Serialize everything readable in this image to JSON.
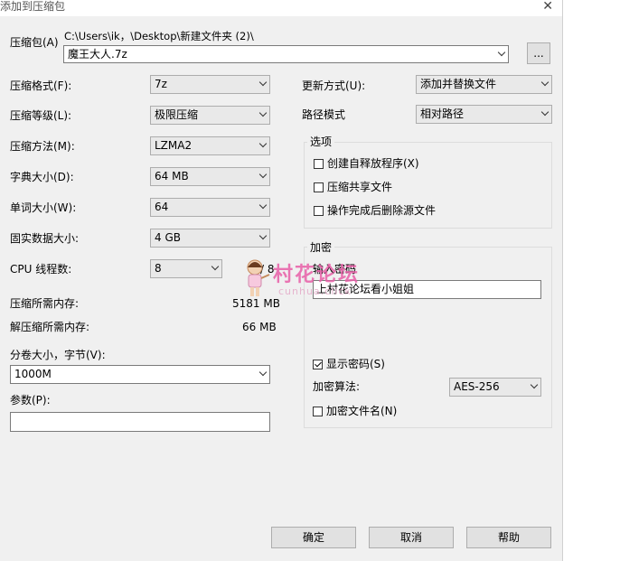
{
  "window": {
    "title": "添加到压缩包",
    "close_glyph": "✕"
  },
  "archive": {
    "label": "压缩包(A)",
    "path": "C:\\Users\\ik，\\Desktop\\新建文件夹 (2)\\",
    "filename": "魔王大人.7z",
    "browse_label": "..."
  },
  "left_fields": {
    "format": {
      "label": "压缩格式(F):",
      "value": "7z"
    },
    "level": {
      "label": "压缩等级(L):",
      "value": "极限压缩"
    },
    "method": {
      "label": "压缩方法(M):",
      "value": "LZMA2"
    },
    "dict": {
      "label": "字典大小(D):",
      "value": "64 MB"
    },
    "word": {
      "label": "单词大小(W):",
      "value": "64"
    },
    "solid": {
      "label": "固实数据大小:",
      "value": "4 GB"
    },
    "cpu": {
      "label": "CPU 线程数:",
      "value": "8",
      "max": "/ 8"
    }
  },
  "memory": {
    "compress_label": "压缩所需内存:",
    "compress_value": "5181 MB",
    "decompress_label": "解压缩所需内存:",
    "decompress_value": "66 MB"
  },
  "volume": {
    "label": "分卷大小，字节(V):",
    "value": "1000M"
  },
  "params": {
    "label": "参数(P):",
    "value": ""
  },
  "right_fields": {
    "update": {
      "label": "更新方式(U):",
      "value": "添加并替换文件"
    },
    "pathmode": {
      "label": "路径模式",
      "value": "相对路径"
    }
  },
  "options": {
    "title": "选项",
    "items": [
      {
        "label": "创建自释放程序(X)",
        "checked": false
      },
      {
        "label": "压缩共享文件",
        "checked": false
      },
      {
        "label": "操作完成后删除源文件",
        "checked": false
      }
    ]
  },
  "encryption": {
    "title": "加密",
    "password_label": "输入密码",
    "password_value": "上村花论坛看小姐姐",
    "show_password": {
      "label": "显示密码(S)",
      "checked": true
    },
    "method_label": "加密算法:",
    "method_value": "AES-256",
    "encrypt_names": {
      "label": "加密文件名(N)",
      "checked": false
    }
  },
  "buttons": {
    "ok": "确定",
    "cancel": "取消",
    "help": "帮助"
  },
  "watermark": {
    "text": "村花论坛",
    "sub": "cunhua.click"
  }
}
